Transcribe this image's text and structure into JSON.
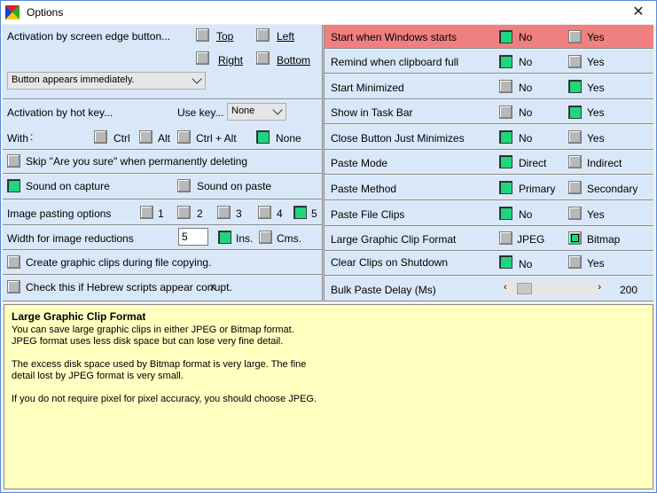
{
  "window": {
    "title": "Options",
    "close_label": "✕"
  },
  "left": {
    "screen_edge": {
      "label": "Activation by screen edge button...",
      "top": "Top",
      "left": "Left",
      "right": "Right",
      "bottom": "Bottom",
      "dropdown": "Button appears immediately."
    },
    "hot_key": {
      "label": "Activation by hot key...",
      "use_key_label": "Use key...",
      "use_key_value": "None",
      "with_label": "With",
      "ctrl": "Ctrl",
      "alt": "Alt",
      "ctrl_alt": "Ctrl + Alt",
      "none": "None"
    },
    "skip_label": "Skip \"Are you sure\" when permanently deleting",
    "sound_capture": "Sound on capture",
    "sound_paste": "Sound on paste",
    "image_pasting": {
      "label": "Image pasting options",
      "o1": "1",
      "o2": "2",
      "o3": "3",
      "o4": "4",
      "o5": "5"
    },
    "width": {
      "label": "Width for image reductions",
      "value": "5",
      "ins": "Ins.",
      "cms": "Cms."
    },
    "create_graphic": "Create graphic clips during file copying.",
    "hebrew": "Check this if Hebrew scripts appear corrupt."
  },
  "right": {
    "rows": [
      {
        "label": "Start when Windows starts",
        "a": "No",
        "b": "Yes"
      },
      {
        "label": "Remind when clipboard full",
        "a": "No",
        "b": "Yes"
      },
      {
        "label": "Start Minimized",
        "a": "No",
        "b": "Yes"
      },
      {
        "label": "Show in Task Bar",
        "a": "No",
        "b": "Yes"
      },
      {
        "label": "Close Button Just Minimizes",
        "a": "No",
        "b": "Yes"
      },
      {
        "label": "Paste Mode",
        "a": "Direct",
        "b": "Indirect"
      },
      {
        "label": "Paste Method",
        "a": "Primary",
        "b": "Secondary"
      },
      {
        "label": "Paste File Clips",
        "a": "No",
        "b": "Yes"
      },
      {
        "label": "Large Graphic Clip Format",
        "a": "JPEG",
        "b": "Bitmap"
      },
      {
        "label": "Clear Clips on Shutdown",
        "a": "No",
        "b": "Yes"
      }
    ],
    "bulk": {
      "label": "Bulk Paste Delay (Ms)",
      "value": "200",
      "level": 0.06
    }
  },
  "help": {
    "title": "Large Graphic Clip Format",
    "p1": "You can save large graphic clips in either JPEG or Bitmap format.",
    "p2": "JPEG format uses less disk space but can lose very fine detail.",
    "p3": "The excess disk space used by Bitmap format is very large. The fine",
    "p4": "detail lost by JPEG format is very small.",
    "p5": "If you do not require pixel for pixel accuracy, you should choose JPEG."
  },
  "colors": {
    "panel": "#d8e8f8",
    "checked": "#1ed67e",
    "highlight": "#f08080",
    "help_bg": "#ffffc0"
  }
}
